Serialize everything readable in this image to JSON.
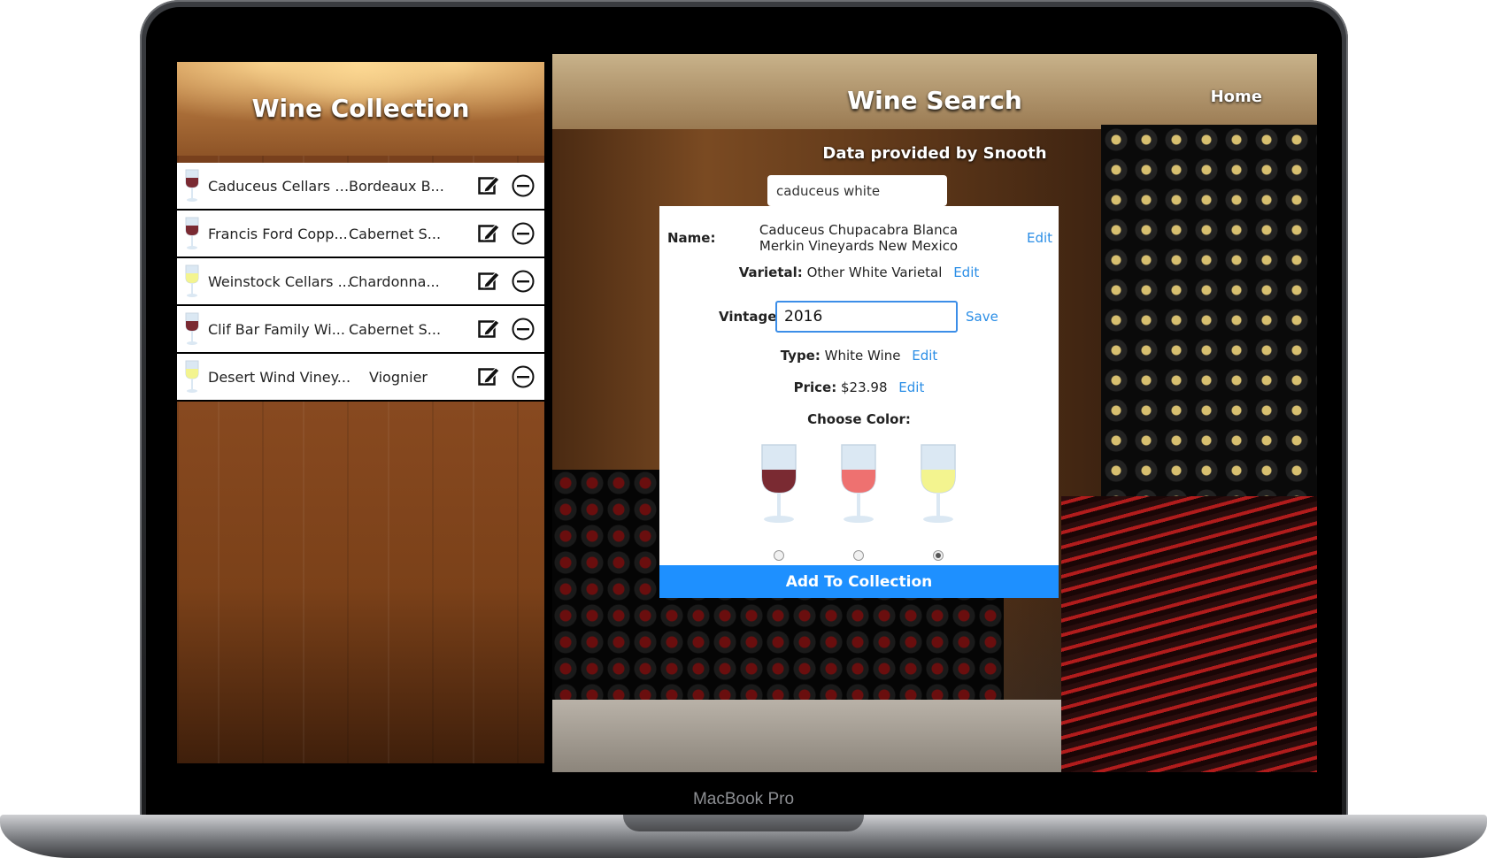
{
  "device": {
    "brand": "MacBook Pro"
  },
  "collection": {
    "title": "Wine Collection",
    "items": [
      {
        "name": "Caduceus Cellars \"...",
        "varietal": "Bordeaux B...",
        "color": "red"
      },
      {
        "name": "Francis Ford Copp...",
        "varietal": "Cabernet S...",
        "color": "red"
      },
      {
        "name": "Weinstock Cellars ...",
        "varietal": "Chardonna...",
        "color": "white"
      },
      {
        "name": "Clif Bar Family Wi...",
        "varietal": "Cabernet S...",
        "color": "red"
      },
      {
        "name": "Desert Wind Viney...",
        "varietal": "Viognier",
        "color": "white"
      }
    ]
  },
  "search": {
    "title": "Wine Search",
    "home_label": "Home",
    "provider_text": "Data provided by Snooth",
    "query": "caduceus white"
  },
  "detail": {
    "name_label": "Name:",
    "name_value": "Caduceus Chupacabra Blanca Merkin Vineyards New Mexico",
    "varietal_label": "Varietal:",
    "varietal_value": "Other White Varietal",
    "vintage_label": "Vintage:",
    "vintage_value": "2016",
    "type_label": "Type:",
    "type_value": "White Wine",
    "price_label": "Price:",
    "price_value": "$23.98",
    "edit_label": "Edit",
    "save_label": "Save",
    "color_label": "Choose Color:",
    "color_options": [
      "red",
      "rose",
      "white"
    ],
    "selected_color": "white",
    "add_button": "Add To Collection"
  },
  "colors": {
    "red_wine": "#7a2a32",
    "rose_wine": "#ee7170",
    "white_wine": "#f3f48f",
    "accent": "#1e90ff",
    "link": "#2b8ee6"
  }
}
